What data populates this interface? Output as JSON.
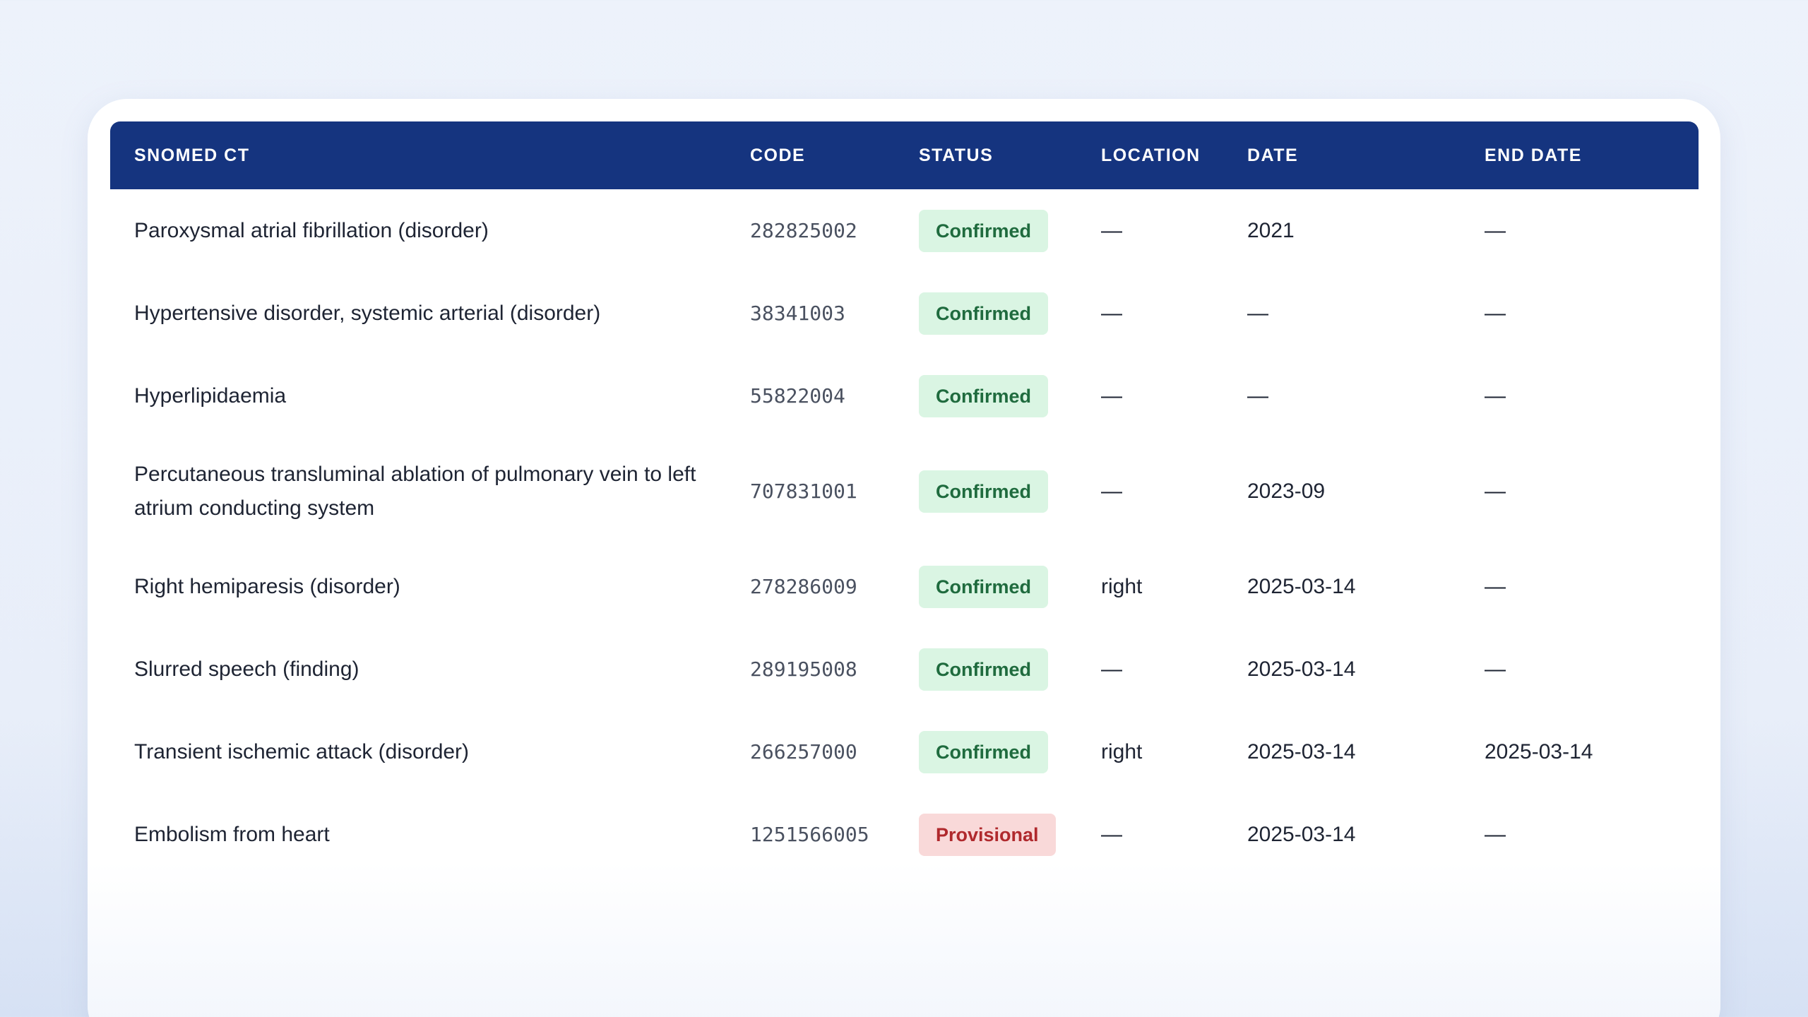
{
  "table": {
    "headers": [
      "SNOMED CT",
      "CODE",
      "STATUS",
      "LOCATION",
      "DATE",
      "END DATE"
    ],
    "status_colors": {
      "header_background": "#15347f",
      "confirmed_background": "#daf5e3",
      "confirmed_text": "#1f6b3e",
      "provisional_background": "#f9d9d9",
      "provisional_text": "#b0292d"
    },
    "rows": [
      {
        "term": "Paroxysmal atrial fibrillation (disorder)",
        "code": "282825002",
        "status": "Confirmed",
        "location": "—",
        "date": "2021",
        "end_date": "—"
      },
      {
        "term": "Hypertensive disorder, systemic arterial (disorder)",
        "code": "38341003",
        "status": "Confirmed",
        "location": "—",
        "date": "—",
        "end_date": "—"
      },
      {
        "term": "Hyperlipidaemia",
        "code": "55822004",
        "status": "Confirmed",
        "location": "—",
        "date": "—",
        "end_date": "—"
      },
      {
        "term": "Percutaneous transluminal ablation of pulmonary vein to left atrium conducting system",
        "code": "707831001",
        "status": "Confirmed",
        "location": "—",
        "date": "2023-09",
        "end_date": "—"
      },
      {
        "term": "Right hemiparesis (disorder)",
        "code": "278286009",
        "status": "Confirmed",
        "location": "right",
        "date": "2025-03-14",
        "end_date": "—"
      },
      {
        "term": "Slurred speech (finding)",
        "code": "289195008",
        "status": "Confirmed",
        "location": "—",
        "date": "2025-03-14",
        "end_date": "—"
      },
      {
        "term": "Transient ischemic attack (disorder)",
        "code": "266257000",
        "status": "Confirmed",
        "location": "right",
        "date": "2025-03-14",
        "end_date": "2025-03-14"
      },
      {
        "term": "Embolism from heart",
        "code": "1251566005",
        "status": "Provisional",
        "location": "—",
        "date": "2025-03-14",
        "end_date": "—"
      }
    ]
  }
}
